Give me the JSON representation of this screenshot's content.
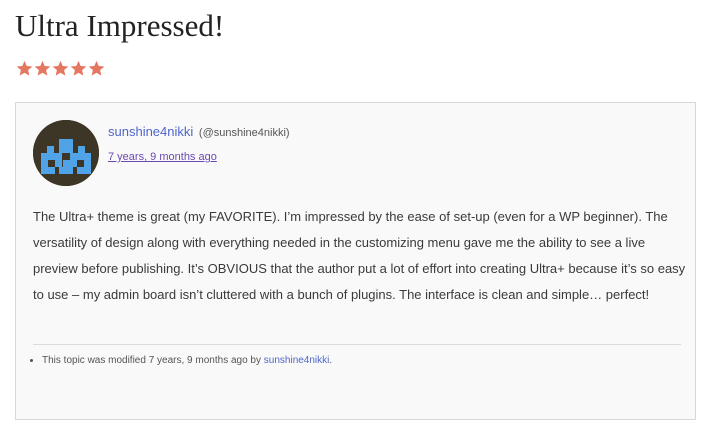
{
  "review": {
    "title": "Ultra Impressed!",
    "rating": 5,
    "star_color": "#e57660"
  },
  "post": {
    "author_name": "sunshine4nikki",
    "author_handle": "(@sunshine4nikki)",
    "date": "7 years, 9 months ago",
    "body": "The Ultra+ theme is great (my FAVORITE). I’m impressed by the ease of set-up (even for a WP beginner). The versatility of design along with everything needed in the customizing menu gave me the ability to see a live preview before publishing. It’s OBVIOUS that the author put a lot of effort into creating Ultra+ because it’s so easy to use – my admin board isn’t cluttered with a bunch of plugins. The interface is clean and simple… perfect!",
    "meta_prefix": "This topic was modified 7 years, 9 months ago by",
    "meta_author": "sunshine4nikki",
    "meta_suffix": ".",
    "link_color": "#4f66c8",
    "avatar_icon": "pixel-identicon-avatar"
  }
}
